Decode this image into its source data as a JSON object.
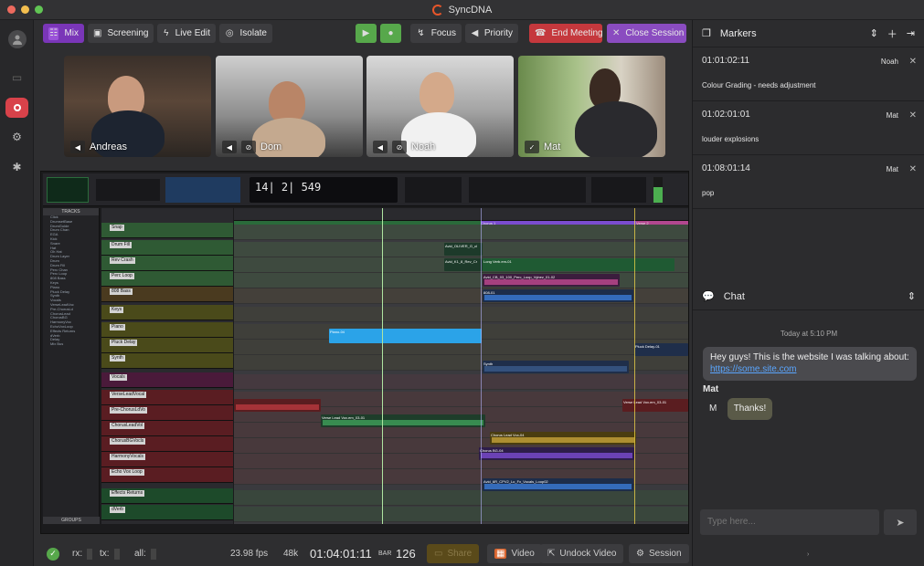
{
  "window": {
    "title": "SyncDNA",
    "traffic": [
      "#ed6a5e",
      "#f4bf4f",
      "#61c554"
    ]
  },
  "toolbar": {
    "mix": "Mix",
    "screening": "Screening",
    "live_edit": "Live Edit",
    "isolate": "Isolate",
    "focus": "Focus",
    "priority": "Priority",
    "end_meeting": "End Meeting",
    "close_session": "Close Session"
  },
  "participants": [
    {
      "name": "Andreas",
      "icon": "speaker-icon"
    },
    {
      "name": "Dom",
      "icon": "mic-muted-icon"
    },
    {
      "name": "Noah",
      "icon": "mic-muted-icon"
    },
    {
      "name": "Mat",
      "icon": "check-icon"
    }
  ],
  "daw": {
    "counter": "14| 2| 549",
    "tracks_header": "TRACKS",
    "groups_header": "GROUPS",
    "track_list": [
      "Click",
      "DrumsetBase",
      "DrumGuide",
      "Drum Chan",
      "EGA",
      "Kick",
      "Snare",
      "Hat",
      "Oh Hat",
      "Drum Layer",
      "Drum",
      "Drum Fill",
      "Perc Chan",
      "Perc Loop",
      "808 Bass",
      "Keys",
      "Piano",
      "Pluck Delay",
      "Synth",
      "Vocals",
      "VerseLeadVoc",
      "Pre-ChorusLd",
      "ChorusLead",
      "ChorusBG",
      "HarmonyVoc",
      "EchoVoxLoop",
      "Effects Returns",
      "dVerb",
      "Delay",
      "Mix Bus"
    ],
    "headers": [
      "Snap",
      "Drum Fill",
      "Rev Crash",
      "Perc Loop",
      "808 Bass",
      "Keys",
      "Piano",
      "Pluck Delay",
      "Synth",
      "Vocals",
      "VerseLeadVocal",
      "Pre-ChorusLdVo",
      "ChorusLeadVol",
      "ChorusBGVocls",
      "HarmonyVocals",
      "Echo Vox Loop",
      "Effects Returns",
      "dVerb"
    ],
    "clips": [
      "Avid_OLIVER_G_cl",
      "Avid_K1_8_Rev_Cr",
      "Long Verb.em-01",
      "Avid_CB_03_100_Perc_Loop_Vybez_01-02",
      "808-01",
      "Piano-04",
      "Pluck Delay-01",
      "Synth",
      "Verse Lead Vox.em_03-01",
      "Verse Lead Vox.em_03-01",
      "Chorus Lead Vox-04",
      "Chorus BG-04",
      "Avid_6R_CPV2_Lo_Fx_Vocals_Loop02",
      "Chorus 1",
      "Verse 2"
    ]
  },
  "markers": {
    "title": "Markers",
    "items": [
      {
        "tc": "01:01:02:11",
        "who": "Noah",
        "note": "Colour Grading - needs adjustment"
      },
      {
        "tc": "01:02:01:01",
        "who": "Mat",
        "note": "louder explosions"
      },
      {
        "tc": "01:08:01:14",
        "who": "Mat",
        "note": "pop"
      }
    ]
  },
  "chat": {
    "title": "Chat",
    "today": "Today at 5:10 PM",
    "msg1": "Hey guys! This is the website I was talking about:",
    "link": "https://some.site.com",
    "sender": "Mat",
    "initial": "M",
    "msg2": "Thanks!",
    "placeholder": "Type here..."
  },
  "status": {
    "rx": "rx:",
    "tx": "tx:",
    "all": "all:",
    "fps": "23.98 fps",
    "rate": "48k",
    "timecode": "01:04:01:11",
    "bar_label": "BAR",
    "bar": "126",
    "share": "Share",
    "video": "Video",
    "undock": "Undock Video",
    "session": "Session"
  }
}
